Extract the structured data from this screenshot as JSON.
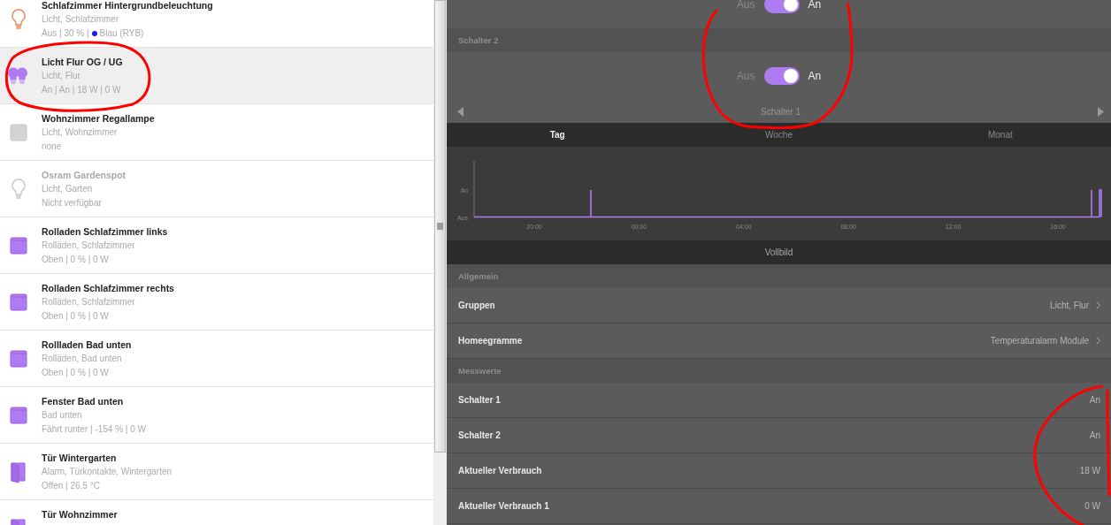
{
  "devices": [
    {
      "name": "Schlafzimmer Hintergrundbeleuchtung",
      "groups": "Licht, Schlafzimmer",
      "status": "Aus | 30 % |",
      "status_tail": "Blau (RYB)",
      "color": "#1a1aff",
      "kind": "bulb",
      "selected": false,
      "disabled": false
    },
    {
      "name": "Licht Flur OG / UG",
      "groups": "Licht, Flur",
      "status": "An | An | 18 W | 0 W",
      "kind": "double-bulb",
      "selected": true,
      "disabled": false
    },
    {
      "name": "Wohnzimmer Regallampe",
      "groups": "Licht, Wohnzimmer",
      "status": "none",
      "kind": "square",
      "selected": false,
      "disabled": false
    },
    {
      "name": "Osram Gardenspot",
      "groups": "Licht, Garten",
      "status": "Nicht verfügbar",
      "kind": "bulb",
      "selected": false,
      "disabled": true
    },
    {
      "name": "Rolladen Schlafzimmer links",
      "groups": "Rolläden, Schlafzimmer",
      "status": "Oben | 0 % | 0 W",
      "kind": "shutter",
      "selected": false,
      "disabled": false
    },
    {
      "name": "Rolladen Schlafzimmer rechts",
      "groups": "Rolläden, Schlafzimmer",
      "status": "Oben | 0 % | 0 W",
      "kind": "shutter",
      "selected": false,
      "disabled": false
    },
    {
      "name": "Rollladen Bad unten",
      "groups": "Rolläden, Bad unten",
      "status": "Oben | 0 % | 0 W",
      "kind": "shutter",
      "selected": false,
      "disabled": false
    },
    {
      "name": "Fenster Bad unten",
      "groups": "Bad unten",
      "status": "Fährt runter | -154 % | 0 W",
      "kind": "shutter",
      "selected": false,
      "disabled": false
    },
    {
      "name": "Tür Wintergarten",
      "groups": "Alarm, Türkontakte, Wintergarten",
      "status": "Offen | 26.5 °C",
      "kind": "door",
      "selected": false,
      "disabled": false
    },
    {
      "name": "Tür Wohnzimmer",
      "kind": "door",
      "selected": false,
      "disabled": false
    }
  ],
  "switches": [
    {
      "off_label": "Aus",
      "on_label": "An",
      "on": true
    },
    {
      "title": "Schalter 2",
      "off_label": "Aus",
      "on_label": "An",
      "on": true
    }
  ],
  "pager": {
    "label": "Schalter 1"
  },
  "range_tabs": [
    {
      "label": "Tag",
      "selected": true
    },
    {
      "label": "Woche",
      "selected": false
    },
    {
      "label": "Monat",
      "selected": false
    }
  ],
  "chart": {
    "y_labels": [
      "An",
      "Aus"
    ],
    "x_labels": [
      "20:00",
      "00:00",
      "04:00",
      "08:00",
      "12:00",
      "16:00"
    ]
  },
  "fullscreen_button": "Vollbild",
  "sections": [
    {
      "title": "Allgemein",
      "rows": [
        {
          "label": "Gruppen",
          "value": "Licht, Flur",
          "link": true
        },
        {
          "label": "Homeegramme",
          "value": "Temperaturalarm Module",
          "link": true
        }
      ]
    },
    {
      "title": "Messwerte",
      "rows": [
        {
          "label": "Schalter 1",
          "value": "An",
          "link": false
        },
        {
          "label": "Schalter 2",
          "value": "An",
          "link": false
        },
        {
          "label": "Aktueller Verbrauch",
          "value": "18 W",
          "link": false
        },
        {
          "label": "Aktueller Verbrauch 1",
          "value": "0 W",
          "link": false
        }
      ]
    }
  ]
}
